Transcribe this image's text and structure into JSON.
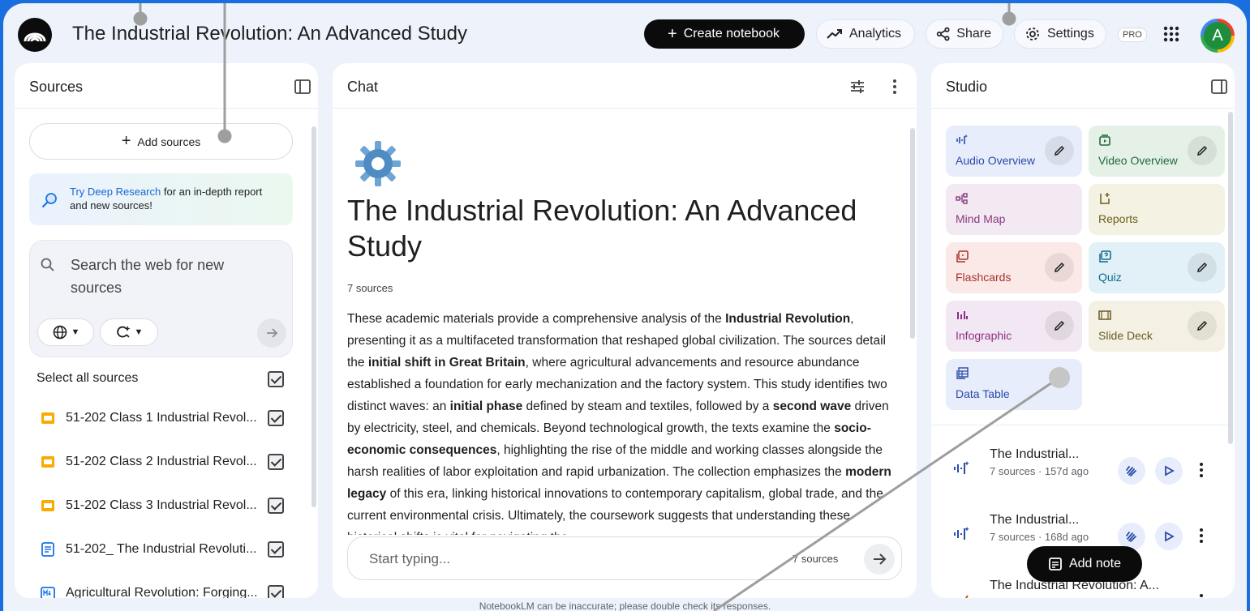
{
  "header": {
    "title": "The Industrial Revolution: An Advanced Study",
    "create_label": "Create notebook",
    "analytics_label": "Analytics",
    "share_label": "Share",
    "settings_label": "Settings",
    "pro_badge": "PRO",
    "avatar_letter": "A"
  },
  "sources_panel": {
    "title": "Sources",
    "add_sources_label": "Add sources",
    "deep_research_link": "Try Deep Research",
    "deep_research_rest": " for an in-depth report and new sources!",
    "web_search_placeholder": "Search the web for new sources",
    "select_all_label": "Select all sources",
    "items": [
      {
        "label": "51-202 Class 1 Industrial Revol...",
        "icon": "slides-icon",
        "checked": true
      },
      {
        "label": "51-202 Class 2 Industrial Revol...",
        "icon": "slides-icon",
        "checked": true
      },
      {
        "label": "51-202 Class 3 Industrial Revol...",
        "icon": "slides-icon",
        "checked": true
      },
      {
        "label": "51-202_ The Industrial Revoluti...",
        "icon": "document-icon",
        "checked": true
      },
      {
        "label": "Agricultural Revolution: Forging...",
        "icon": "markdown-icon",
        "checked": true
      }
    ]
  },
  "chat_panel": {
    "title": "Chat",
    "heading": "The Industrial Revolution: An Advanced Study",
    "source_count": "7 sources",
    "summary_segments": [
      {
        "t": "These academic materials provide a comprehensive analysis of the ",
        "b": false
      },
      {
        "t": "Industrial Revolution",
        "b": true
      },
      {
        "t": ", presenting it as a multifaceted transformation that reshaped global civilization. The sources detail the ",
        "b": false
      },
      {
        "t": "initial shift in Great Britain",
        "b": true
      },
      {
        "t": ", where agricultural advancements and resource abundance established a foundation for early mechanization and the factory system. This study identifies two distinct waves: an ",
        "b": false
      },
      {
        "t": "initial phase",
        "b": true
      },
      {
        "t": " defined by steam and textiles, followed by a ",
        "b": false
      },
      {
        "t": "second wave",
        "b": true
      },
      {
        "t": " driven by electricity, steel, and chemicals. Beyond technological growth, the texts examine the ",
        "b": false
      },
      {
        "t": "socio-economic consequences",
        "b": true
      },
      {
        "t": ", highlighting the rise of the middle and working classes alongside the harsh realities of labor exploitation and rapid urbanization. The collection emphasizes the ",
        "b": false
      },
      {
        "t": "modern legacy",
        "b": true
      },
      {
        "t": " of this era, linking historical innovations to contemporary capitalism, global trade, and the current environmental crisis. Ultimately, the coursework suggests that understanding these historical shifts is vital for navigating the",
        "b": false
      }
    ],
    "input_placeholder": "Start typing...",
    "input_source_count": "7 sources"
  },
  "studio_panel": {
    "title": "Studio",
    "tiles": {
      "audio": "Audio Overview",
      "video": "Video Overview",
      "mind_map": "Mind Map",
      "reports": "Reports",
      "flashcards": "Flashcards",
      "quiz": "Quiz",
      "infographic": "Infographic",
      "slide_deck": "Slide Deck",
      "data_table": "Data Table"
    },
    "notes": [
      {
        "title": "The Industrial...",
        "meta": "7 sources · 157d ago",
        "icon": "audio-wave-icon"
      },
      {
        "title": "The Industrial...",
        "meta": "7 sources · 168d ago",
        "icon": "audio-wave-icon"
      },
      {
        "title": "The Industrial Revolution: A...",
        "meta": "",
        "icon": "mind-map-icon"
      }
    ],
    "add_note_label": "Add note"
  },
  "footer": {
    "disclaimer": "NotebookLM can be inaccurate; please double check its responses."
  },
  "colors": {
    "frame_blue": "#1a6fe0",
    "window_bg": "#eef2fb",
    "link_blue": "#1967d2"
  }
}
